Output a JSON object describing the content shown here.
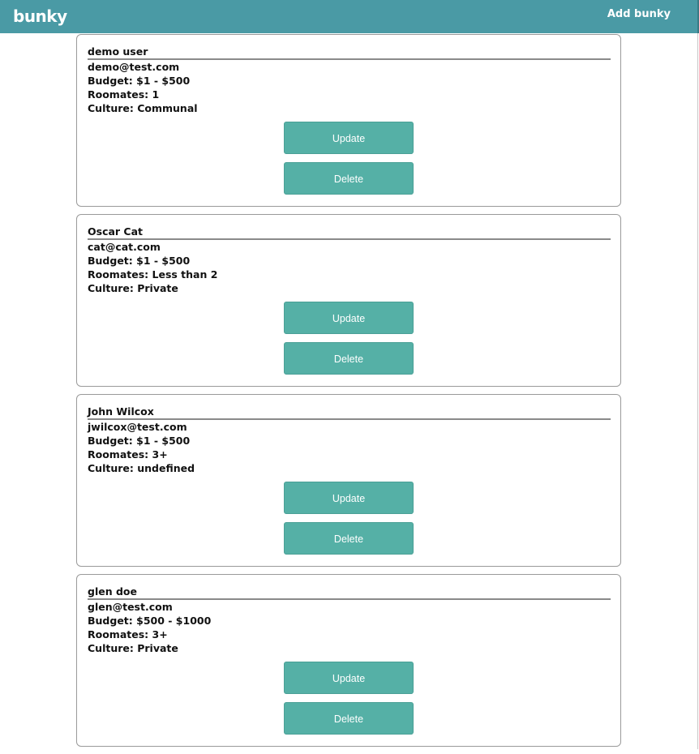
{
  "navbar": {
    "brand": "bunky",
    "add_link": "Add bunky"
  },
  "cards": [
    {
      "name": "demo user",
      "email": "demo@test.com",
      "budget": "Budget: $1 - $500",
      "roommates": "Roomates: 1",
      "culture": "Culture: Communal",
      "update_label": "Update",
      "delete_label": "Delete"
    },
    {
      "name": "Oscar Cat",
      "email": "cat@cat.com",
      "budget": "Budget: $1 - $500",
      "roommates": "Roomates: Less than 2",
      "culture": "Culture: Private",
      "update_label": "Update",
      "delete_label": "Delete"
    },
    {
      "name": "John Wilcox",
      "email": "jwilcox@test.com",
      "budget": "Budget: $1 - $500",
      "roommates": "Roomates: 3+",
      "culture": "Culture: undefined",
      "update_label": "Update",
      "delete_label": "Delete"
    },
    {
      "name": "glen doe",
      "email": "glen@test.com",
      "budget": "Budget: $500 - $1000",
      "roommates": "Roomates: 3+",
      "culture": "Culture: Private",
      "update_label": "Update",
      "delete_label": "Delete"
    }
  ],
  "colors": {
    "navbar": "#4a9aa5",
    "button": "#55b0a6"
  }
}
